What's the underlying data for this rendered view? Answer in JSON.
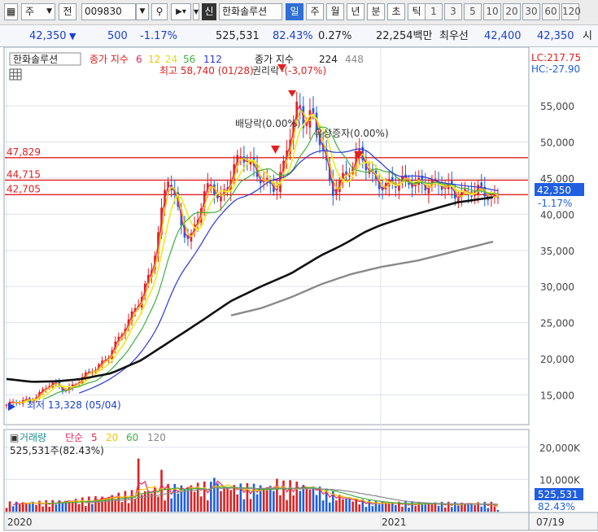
{
  "toolbar": {
    "market": "주",
    "jeon": "전",
    "code": "009830",
    "sin": "신",
    "name": "한화솔루션",
    "periods": [
      "일",
      "주",
      "월",
      "년",
      "분",
      "초",
      "틱"
    ],
    "active_period": "일",
    "intervals": [
      "1",
      "3",
      "5",
      "10",
      "20",
      "30",
      "60",
      "120"
    ]
  },
  "quote": {
    "price": "42,350",
    "change": "500",
    "change_pct": "-1.17%",
    "volume": "525,531",
    "vol_ratio": "82.43%",
    "turnover_pct": "0.27%",
    "amount": "22,254백만",
    "best_label": "최우선",
    "ask": "42,400",
    "bid": "42,350",
    "tail": "시"
  },
  "colors": {
    "up": "#e02020",
    "down": "#1f5fe0",
    "ma6": "#e8285a",
    "ma12": "#f5c400",
    "ma24": "#f0ec30",
    "ma56": "#40b040",
    "ma112": "#2838d8",
    "ma224": "#101010",
    "ma448": "#8a8a8a",
    "hline": "#e02020"
  },
  "chart_data": [
    {
      "type": "line",
      "title": "한화솔루션",
      "legend": {
        "label": "종가 지수",
        "periods1": [
          "6",
          "12",
          "24",
          "56",
          "112"
        ],
        "label2": "종가 지수",
        "periods2": [
          "224",
          "448"
        ]
      },
      "lc": "LC:217.75",
      "hc": "HC:-27.90",
      "ylim": [
        11000,
        63000
      ],
      "yticks": [
        "55,000",
        "50,000",
        "45,000",
        "40,000",
        "35,000",
        "30,000",
        "25,000",
        "20,000",
        "15,000"
      ],
      "ytick_values": [
        55000,
        50000,
        45000,
        40000,
        35000,
        30000,
        25000,
        20000,
        15000
      ],
      "xlabels": [
        "2020",
        "2021"
      ],
      "xlabel_values": [
        0,
        1
      ],
      "right_date": "07/19",
      "current": {
        "value": 42350,
        "label": "42,350",
        "pct": "-1.17%"
      },
      "hlines": [
        {
          "value": 47829,
          "label": "47,829"
        },
        {
          "value": 44715,
          "label": "44,715"
        },
        {
          "value": 42705,
          "label": "42,705"
        }
      ],
      "annotations": {
        "high": {
          "text": "최고 58,740 (01/28)",
          "value": 58740
        },
        "high_tail": "-(-3,07%)",
        "low": {
          "text": "최저 13,328 (05/04)",
          "value": 13328
        },
        "dividend": "배당락(0.00%)",
        "capital": "유상증자(0.00%)",
        "rights": "권리락"
      },
      "close_anchors": [
        [
          0,
          13500
        ],
        [
          0.08,
          14800
        ],
        [
          0.12,
          16500
        ],
        [
          0.16,
          15800
        ],
        [
          0.2,
          17200
        ],
        [
          0.24,
          18600
        ],
        [
          0.27,
          20500
        ],
        [
          0.3,
          22800
        ],
        [
          0.33,
          25300
        ],
        [
          0.36,
          28800
        ],
        [
          0.39,
          33200
        ],
        [
          0.41,
          38500
        ],
        [
          0.43,
          45000
        ],
        [
          0.45,
          42000
        ],
        [
          0.47,
          38500
        ],
        [
          0.49,
          36500
        ],
        [
          0.51,
          39500
        ],
        [
          0.53,
          42500
        ],
        [
          0.55,
          44000
        ],
        [
          0.57,
          42000
        ],
        [
          0.59,
          44500
        ],
        [
          0.61,
          47000
        ],
        [
          0.64,
          47500
        ],
        [
          0.66,
          46000
        ],
        [
          0.68,
          45500
        ],
        [
          0.7,
          44500
        ],
        [
          0.72,
          43500
        ],
        [
          0.74,
          46000
        ],
        [
          0.76,
          51500
        ],
        [
          0.78,
          56000
        ],
        [
          0.79,
          53000
        ],
        [
          0.81,
          54500
        ],
        [
          0.83,
          51000
        ],
        [
          0.85,
          48000
        ],
        [
          0.86,
          44500
        ],
        [
          0.87,
          42500
        ],
        [
          0.88,
          44500
        ],
        [
          0.9,
          45500
        ],
        [
          0.92,
          46500
        ],
        [
          0.94,
          48000
        ],
        [
          0.96,
          46500
        ],
        [
          0.98,
          45000
        ],
        [
          1.0,
          44500
        ],
        [
          1.05,
          44000
        ],
        [
          1.1,
          44800
        ],
        [
          1.15,
          43800
        ],
        [
          1.2,
          43200
        ],
        [
          1.25,
          43000
        ],
        [
          1.3,
          42350
        ]
      ],
      "ma224_anchors": [
        [
          0,
          17200
        ],
        [
          0.07,
          16800
        ],
        [
          0.14,
          16900
        ],
        [
          0.2,
          17200
        ],
        [
          0.28,
          18000
        ],
        [
          0.36,
          19800
        ],
        [
          0.44,
          22500
        ],
        [
          0.52,
          25200
        ],
        [
          0.6,
          28000
        ],
        [
          0.68,
          30000
        ],
        [
          0.76,
          31800
        ],
        [
          0.84,
          34300
        ],
        [
          0.9,
          35800
        ],
        [
          0.96,
          37600
        ],
        [
          1.0,
          38500
        ],
        [
          1.06,
          39500
        ],
        [
          1.12,
          40400
        ],
        [
          1.2,
          41600
        ],
        [
          1.3,
          42350
        ]
      ],
      "ma448_anchors": [
        [
          0.6,
          26000
        ],
        [
          0.68,
          27000
        ],
        [
          0.76,
          28500
        ],
        [
          0.84,
          30300
        ],
        [
          0.92,
          31700
        ],
        [
          1.0,
          32700
        ],
        [
          1.1,
          33600
        ],
        [
          1.2,
          34900
        ],
        [
          1.3,
          36200
        ]
      ]
    },
    {
      "type": "bar",
      "title": "거래량",
      "legend": {
        "label": "단순",
        "periods": [
          "5",
          "20",
          "60",
          "120"
        ]
      },
      "summary": "525,531주(82.43%)",
      "yticks": [
        "20,000K",
        "10,000K"
      ],
      "ytick_values": [
        20000000,
        10000000
      ],
      "ylim": [
        0,
        25000000
      ],
      "current": {
        "value": 525531,
        "label": "525,531",
        "pct": "82.43%"
      }
    }
  ]
}
